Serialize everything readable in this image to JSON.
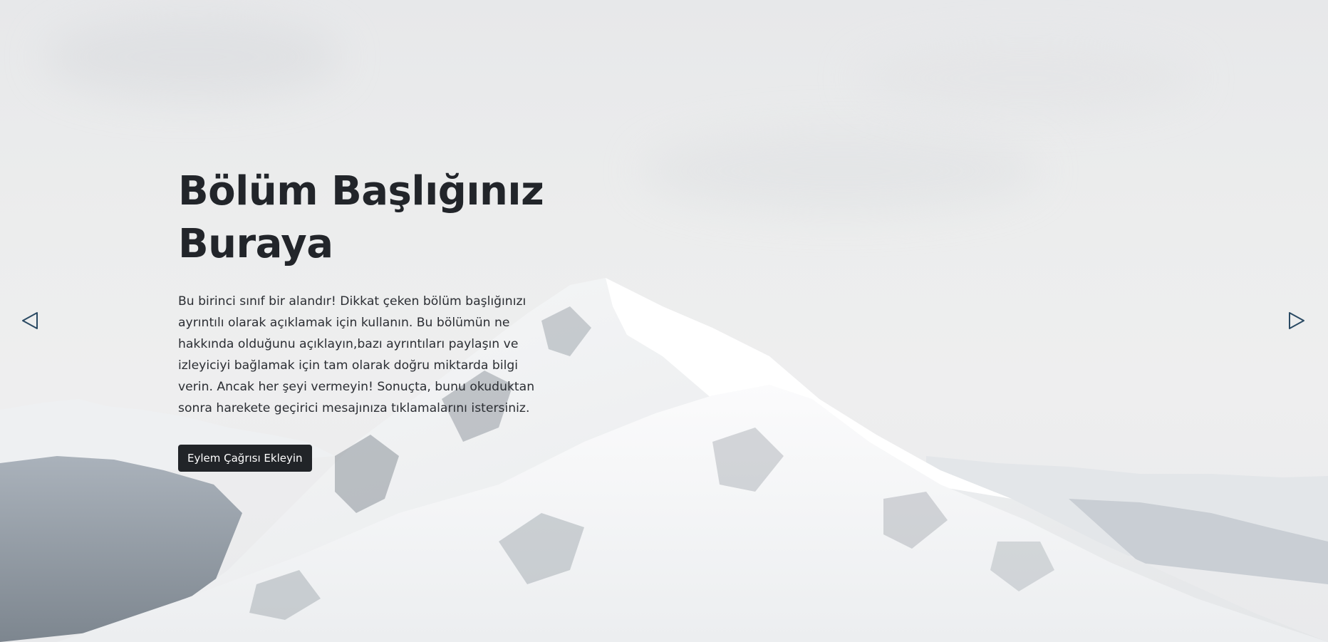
{
  "hero": {
    "title": "Bölüm Başlığınız Buraya",
    "description": "Bu birinci sınıf bir alandır! Dikkat çeken bölüm başlığınızı ayrıntılı olarak açıklamak için kullanın. Bu bölümün ne hakkında olduğunu açıklayın,bazı ayrıntıları paylaşın ve izleyiciyi bağlamak için tam olarak doğru miktarda bilgi verin. Ancak her şeyi vermeyin! Sonuçta, bunu okuduktan sonra harekete geçirici mesajınıza tıklamalarını istersiniz.",
    "cta_label": "Eylem Çağrısı Ekleyin"
  },
  "carousel": {
    "prev_icon": "triangle-left-outline-icon",
    "next_icon": "triangle-right-outline-icon"
  },
  "colors": {
    "text": "#22252a",
    "button_bg": "#212428",
    "button_text": "#ffffff",
    "arrow": "#2a4a63"
  }
}
